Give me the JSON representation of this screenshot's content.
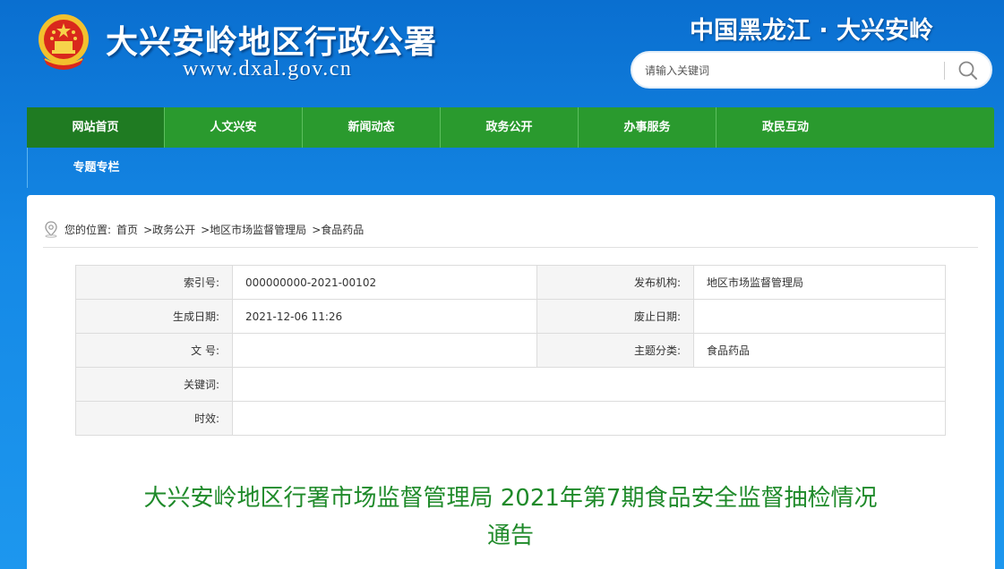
{
  "header": {
    "site_title": "大兴安岭地区行政公署",
    "site_url": "www.dxal.gov.cn",
    "slogan": "中国黑龙江 · 大兴安岭",
    "search_placeholder": "请输入关键词"
  },
  "nav": {
    "items": [
      "网站首页",
      "人文兴安",
      "新闻动态",
      "政务公开",
      "办事服务",
      "政民互动"
    ],
    "second_row": [
      "专题专栏"
    ]
  },
  "breadcrumb": {
    "prefix": "您的位置:",
    "items": [
      "首页",
      ">政务公开",
      ">地区市场监督管理局",
      ">食品药品"
    ]
  },
  "meta_table": {
    "index_label": "索引号:",
    "index_value": "000000000-2021-00102",
    "publisher_label": "发布机构:",
    "publisher_value": "地区市场监督管理局",
    "date_label": "生成日期:",
    "date_value": "2021-12-06 11:26",
    "expire_label": "废止日期:",
    "expire_value": "",
    "docno_label": "文 号:",
    "docno_value": "",
    "topic_label": "主题分类:",
    "topic_value": "食品药品",
    "keywords_label": "关键词:",
    "keywords_value": "",
    "validity_label": "时效:",
    "validity_value": ""
  },
  "article": {
    "title_line1": "大兴安岭地区行署市场监督管理局 2021年第7期食品安全监督抽检情况",
    "title_line2": "通告"
  },
  "colors": {
    "nav_green": "#2a9a2e",
    "nav_active": "#1f7b22",
    "title_green": "#1f8a2a",
    "bg_blue": "#1589e6"
  },
  "icons": [
    "national-emblem-icon",
    "search-icon",
    "location-icon"
  ]
}
